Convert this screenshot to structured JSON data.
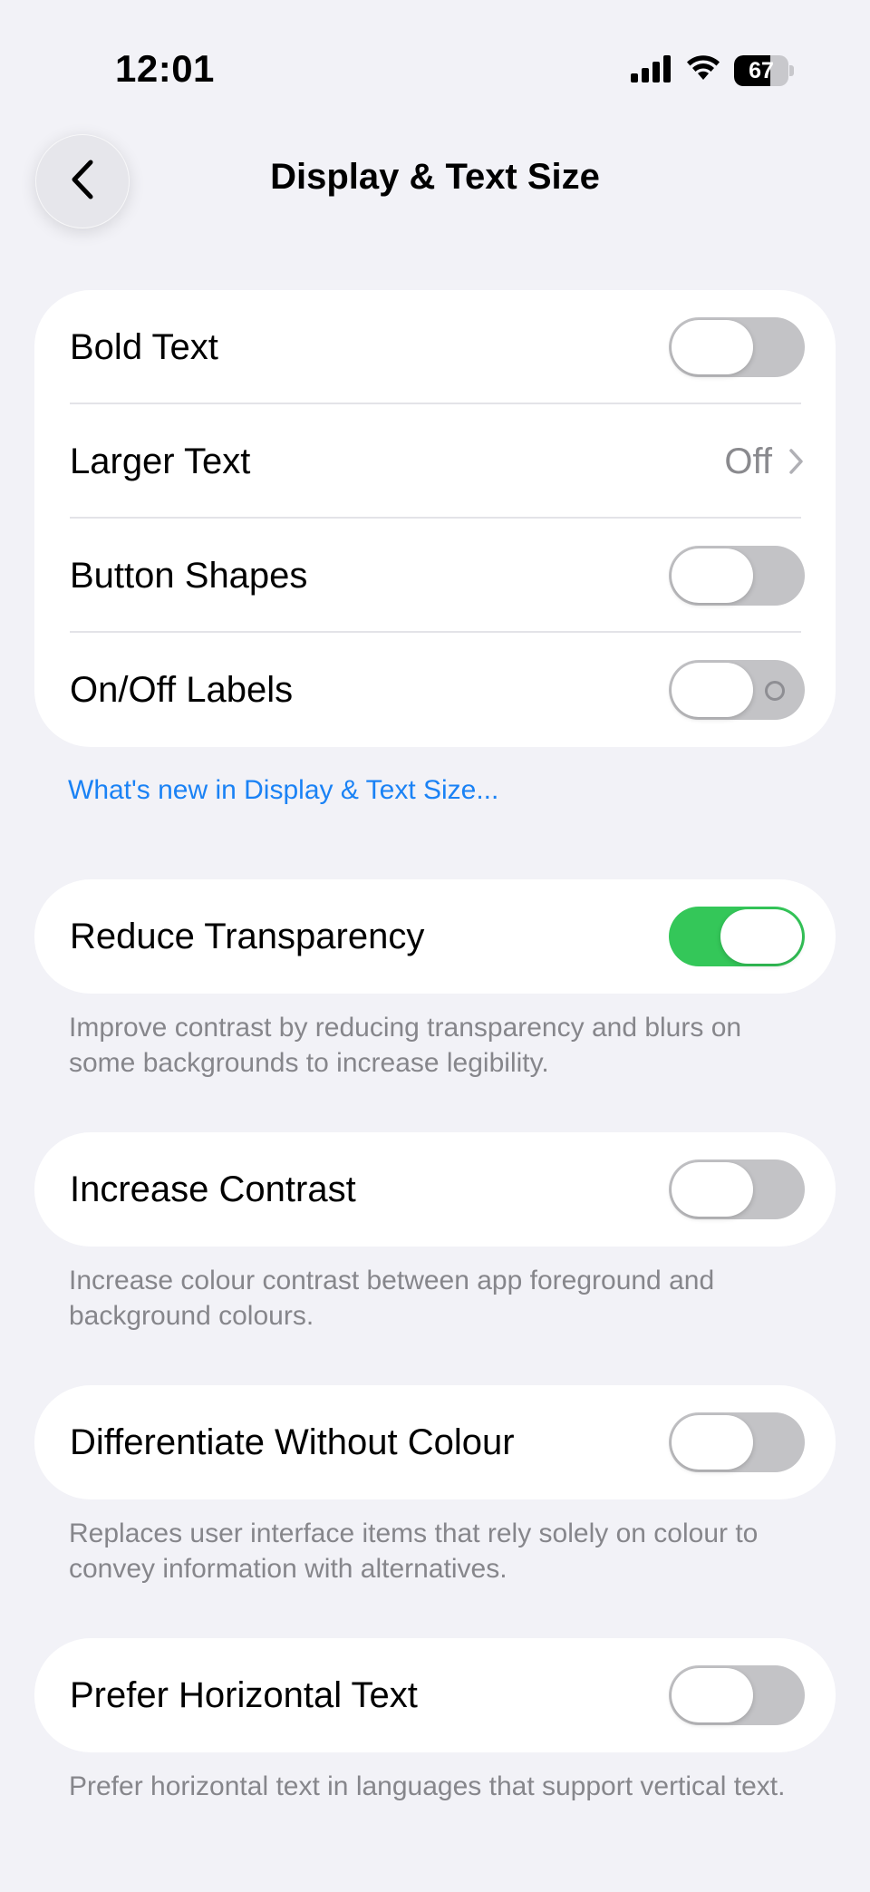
{
  "status_bar": {
    "time": "12:01",
    "battery_level": "67",
    "battery_fraction": 0.67,
    "icons": [
      "cellular-signal-icon",
      "wifi-icon",
      "battery-icon"
    ]
  },
  "nav": {
    "title": "Display & Text Size",
    "back_icon": "chevron-left-icon"
  },
  "group_text": {
    "rows": [
      {
        "label": "Bold Text",
        "toggle": false
      },
      {
        "label": "Larger Text",
        "value": "Off"
      },
      {
        "label": "Button Shapes",
        "toggle": false
      },
      {
        "label": "On/Off Labels",
        "toggle": false
      }
    ]
  },
  "whats_new_link": "What's new in Display & Text Size...",
  "reduce_transparency": {
    "label": "Reduce Transparency",
    "toggle": true,
    "footer": "Improve contrast by reducing transparency and blurs on some backgrounds to increase legibility."
  },
  "increase_contrast": {
    "label": "Increase Contrast",
    "toggle": false,
    "footer": "Increase colour contrast between app foreground and background colours."
  },
  "differentiate_without_colour": {
    "label": "Differentiate Without Colour",
    "toggle": false,
    "footer": "Replaces user interface items that rely solely on colour to convey information with alternatives."
  },
  "prefer_horizontal_text": {
    "label": "Prefer Horizontal Text",
    "toggle": false,
    "footer": "Prefer horizontal text in languages that support vertical text."
  },
  "colors": {
    "background": "#f2f2f7",
    "toggle_on": "#34c759",
    "toggle_off": "#c3c3c6",
    "link": "#1a82f5",
    "secondary_text": "#86868b"
  }
}
